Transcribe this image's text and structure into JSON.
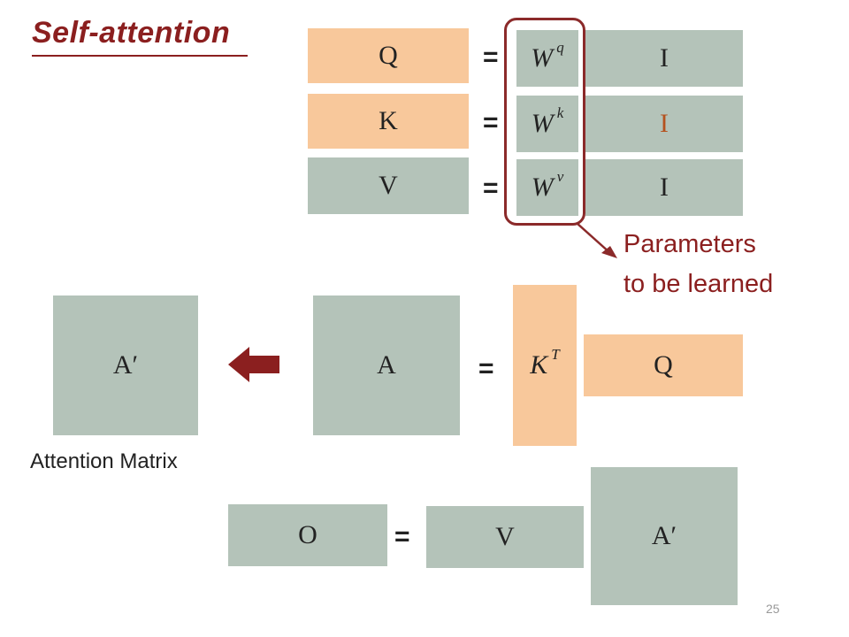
{
  "title": "Self-attention",
  "top": {
    "rows": [
      {
        "lhs": "Q",
        "eq": "=",
        "w": "W",
        "w_sup": "q",
        "rhs": "I"
      },
      {
        "lhs": "K",
        "eq": "=",
        "w": "W",
        "w_sup": "k",
        "rhs": "I"
      },
      {
        "lhs": "V",
        "eq": "=",
        "w": "W",
        "w_sup": "v",
        "rhs": "I"
      }
    ],
    "param_note": [
      "Parameters",
      "to be learned"
    ]
  },
  "middle": {
    "a_prime": "A′",
    "a": "A",
    "eq": "=",
    "k": "K",
    "k_sup": "T",
    "q": "Q",
    "attention_label": "Attention Matrix"
  },
  "bottom": {
    "o": "O",
    "eq": "=",
    "v": "V",
    "a_prime": "A′"
  },
  "page_number": "25",
  "colors": {
    "accent": "#8b1f1f",
    "gray_block": "#b4c3b9",
    "orange_block": "#f8c89b"
  }
}
